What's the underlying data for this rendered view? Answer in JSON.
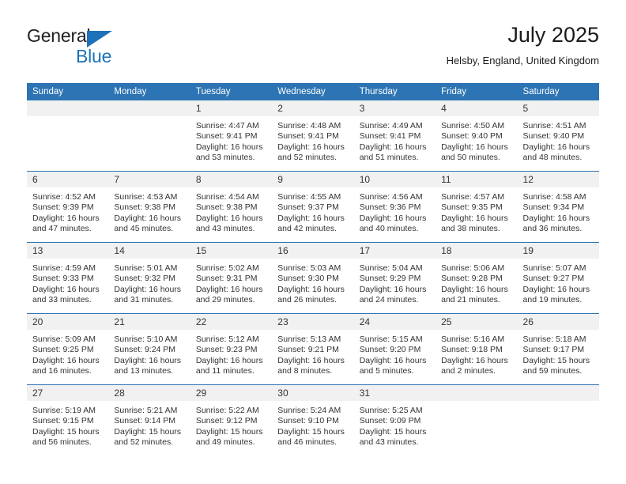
{
  "logo": {
    "word1": "General",
    "word2": "Blue",
    "triangle_color": "#1d71b8"
  },
  "header": {
    "title": "July 2025",
    "subtitle": "Helsby, England, United Kingdom"
  },
  "colors": {
    "header_blue": "#2c74b3",
    "daynum_band": "#f1f1f1",
    "text": "#333333"
  },
  "weekday_headers": [
    "Sunday",
    "Monday",
    "Tuesday",
    "Wednesday",
    "Thursday",
    "Friday",
    "Saturday"
  ],
  "weeks": [
    [
      {
        "day": "",
        "sunrise": "",
        "sunset": "",
        "daylight": ""
      },
      {
        "day": "",
        "sunrise": "",
        "sunset": "",
        "daylight": ""
      },
      {
        "day": "1",
        "sunrise": "Sunrise: 4:47 AM",
        "sunset": "Sunset: 9:41 PM",
        "daylight": "Daylight: 16 hours and 53 minutes."
      },
      {
        "day": "2",
        "sunrise": "Sunrise: 4:48 AM",
        "sunset": "Sunset: 9:41 PM",
        "daylight": "Daylight: 16 hours and 52 minutes."
      },
      {
        "day": "3",
        "sunrise": "Sunrise: 4:49 AM",
        "sunset": "Sunset: 9:41 PM",
        "daylight": "Daylight: 16 hours and 51 minutes."
      },
      {
        "day": "4",
        "sunrise": "Sunrise: 4:50 AM",
        "sunset": "Sunset: 9:40 PM",
        "daylight": "Daylight: 16 hours and 50 minutes."
      },
      {
        "day": "5",
        "sunrise": "Sunrise: 4:51 AM",
        "sunset": "Sunset: 9:40 PM",
        "daylight": "Daylight: 16 hours and 48 minutes."
      }
    ],
    [
      {
        "day": "6",
        "sunrise": "Sunrise: 4:52 AM",
        "sunset": "Sunset: 9:39 PM",
        "daylight": "Daylight: 16 hours and 47 minutes."
      },
      {
        "day": "7",
        "sunrise": "Sunrise: 4:53 AM",
        "sunset": "Sunset: 9:38 PM",
        "daylight": "Daylight: 16 hours and 45 minutes."
      },
      {
        "day": "8",
        "sunrise": "Sunrise: 4:54 AM",
        "sunset": "Sunset: 9:38 PM",
        "daylight": "Daylight: 16 hours and 43 minutes."
      },
      {
        "day": "9",
        "sunrise": "Sunrise: 4:55 AM",
        "sunset": "Sunset: 9:37 PM",
        "daylight": "Daylight: 16 hours and 42 minutes."
      },
      {
        "day": "10",
        "sunrise": "Sunrise: 4:56 AM",
        "sunset": "Sunset: 9:36 PM",
        "daylight": "Daylight: 16 hours and 40 minutes."
      },
      {
        "day": "11",
        "sunrise": "Sunrise: 4:57 AM",
        "sunset": "Sunset: 9:35 PM",
        "daylight": "Daylight: 16 hours and 38 minutes."
      },
      {
        "day": "12",
        "sunrise": "Sunrise: 4:58 AM",
        "sunset": "Sunset: 9:34 PM",
        "daylight": "Daylight: 16 hours and 36 minutes."
      }
    ],
    [
      {
        "day": "13",
        "sunrise": "Sunrise: 4:59 AM",
        "sunset": "Sunset: 9:33 PM",
        "daylight": "Daylight: 16 hours and 33 minutes."
      },
      {
        "day": "14",
        "sunrise": "Sunrise: 5:01 AM",
        "sunset": "Sunset: 9:32 PM",
        "daylight": "Daylight: 16 hours and 31 minutes."
      },
      {
        "day": "15",
        "sunrise": "Sunrise: 5:02 AM",
        "sunset": "Sunset: 9:31 PM",
        "daylight": "Daylight: 16 hours and 29 minutes."
      },
      {
        "day": "16",
        "sunrise": "Sunrise: 5:03 AM",
        "sunset": "Sunset: 9:30 PM",
        "daylight": "Daylight: 16 hours and 26 minutes."
      },
      {
        "day": "17",
        "sunrise": "Sunrise: 5:04 AM",
        "sunset": "Sunset: 9:29 PM",
        "daylight": "Daylight: 16 hours and 24 minutes."
      },
      {
        "day": "18",
        "sunrise": "Sunrise: 5:06 AM",
        "sunset": "Sunset: 9:28 PM",
        "daylight": "Daylight: 16 hours and 21 minutes."
      },
      {
        "day": "19",
        "sunrise": "Sunrise: 5:07 AM",
        "sunset": "Sunset: 9:27 PM",
        "daylight": "Daylight: 16 hours and 19 minutes."
      }
    ],
    [
      {
        "day": "20",
        "sunrise": "Sunrise: 5:09 AM",
        "sunset": "Sunset: 9:25 PM",
        "daylight": "Daylight: 16 hours and 16 minutes."
      },
      {
        "day": "21",
        "sunrise": "Sunrise: 5:10 AM",
        "sunset": "Sunset: 9:24 PM",
        "daylight": "Daylight: 16 hours and 13 minutes."
      },
      {
        "day": "22",
        "sunrise": "Sunrise: 5:12 AM",
        "sunset": "Sunset: 9:23 PM",
        "daylight": "Daylight: 16 hours and 11 minutes."
      },
      {
        "day": "23",
        "sunrise": "Sunrise: 5:13 AM",
        "sunset": "Sunset: 9:21 PM",
        "daylight": "Daylight: 16 hours and 8 minutes."
      },
      {
        "day": "24",
        "sunrise": "Sunrise: 5:15 AM",
        "sunset": "Sunset: 9:20 PM",
        "daylight": "Daylight: 16 hours and 5 minutes."
      },
      {
        "day": "25",
        "sunrise": "Sunrise: 5:16 AM",
        "sunset": "Sunset: 9:18 PM",
        "daylight": "Daylight: 16 hours and 2 minutes."
      },
      {
        "day": "26",
        "sunrise": "Sunrise: 5:18 AM",
        "sunset": "Sunset: 9:17 PM",
        "daylight": "Daylight: 15 hours and 59 minutes."
      }
    ],
    [
      {
        "day": "27",
        "sunrise": "Sunrise: 5:19 AM",
        "sunset": "Sunset: 9:15 PM",
        "daylight": "Daylight: 15 hours and 56 minutes."
      },
      {
        "day": "28",
        "sunrise": "Sunrise: 5:21 AM",
        "sunset": "Sunset: 9:14 PM",
        "daylight": "Daylight: 15 hours and 52 minutes."
      },
      {
        "day": "29",
        "sunrise": "Sunrise: 5:22 AM",
        "sunset": "Sunset: 9:12 PM",
        "daylight": "Daylight: 15 hours and 49 minutes."
      },
      {
        "day": "30",
        "sunrise": "Sunrise: 5:24 AM",
        "sunset": "Sunset: 9:10 PM",
        "daylight": "Daylight: 15 hours and 46 minutes."
      },
      {
        "day": "31",
        "sunrise": "Sunrise: 5:25 AM",
        "sunset": "Sunset: 9:09 PM",
        "daylight": "Daylight: 15 hours and 43 minutes."
      },
      {
        "day": "",
        "sunrise": "",
        "sunset": "",
        "daylight": ""
      },
      {
        "day": "",
        "sunrise": "",
        "sunset": "",
        "daylight": ""
      }
    ]
  ]
}
